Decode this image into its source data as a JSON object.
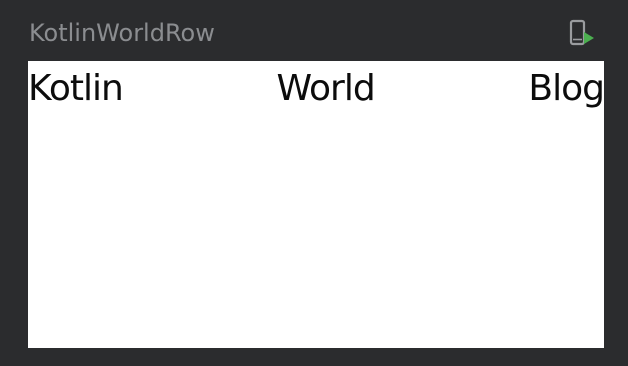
{
  "preview": {
    "title": "KotlinWorldRow"
  },
  "toolbar": {
    "deploy_icon": "deploy-to-device-icon",
    "deploy_icon_colors": {
      "device": "#9a9c9f",
      "arrow": "#4caf50"
    }
  },
  "row": {
    "items": [
      {
        "text": "Kotlin"
      },
      {
        "text": "World"
      },
      {
        "text": "Blog"
      }
    ]
  },
  "colors": {
    "background": "#2b2c2e",
    "title": "#8b8d90",
    "surface": "#ffffff",
    "text": "#0c0c0c"
  }
}
